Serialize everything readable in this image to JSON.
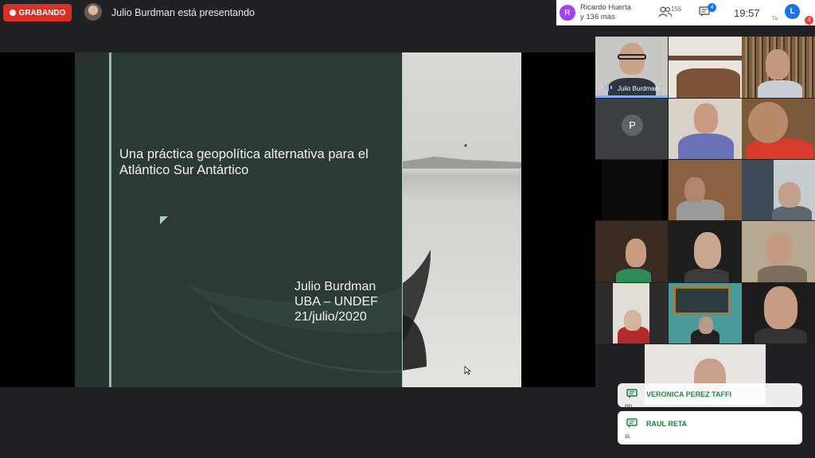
{
  "recording": {
    "label": "GRABANDO"
  },
  "presenter": {
    "text": "Julio Burdman está presentando"
  },
  "participants_panel": {
    "avatar_letter": "R",
    "line1": "Ricardo Huerta",
    "line2": "y 136 más"
  },
  "toolbar": {
    "people_count": "155",
    "chat_badge": "4",
    "time": "19:57",
    "user_initial": "L",
    "you_label": "Tú",
    "notifications_count": "3"
  },
  "slide": {
    "title_line1": "Una práctica geopolítica alternativa para el",
    "title_line2": "Atlántico Sur Antártico",
    "author": "Julio Burdman",
    "affiliation": "UBA – UNDEF",
    "date": "21/julio/2020"
  },
  "grid": {
    "speaker_name": "Julio Burdman",
    "p_initial": "P"
  },
  "chat_notifications": [
    {
      "sender": "VERONICA PEREZ TAFFI",
      "message": "no"
    },
    {
      "sender": "RAUL RETA",
      "message": "si."
    }
  ],
  "colors": {
    "record": "#d93025",
    "accent": "#1a73e8",
    "chat_sender": "#188038",
    "speaking": "#8ab4f8"
  }
}
